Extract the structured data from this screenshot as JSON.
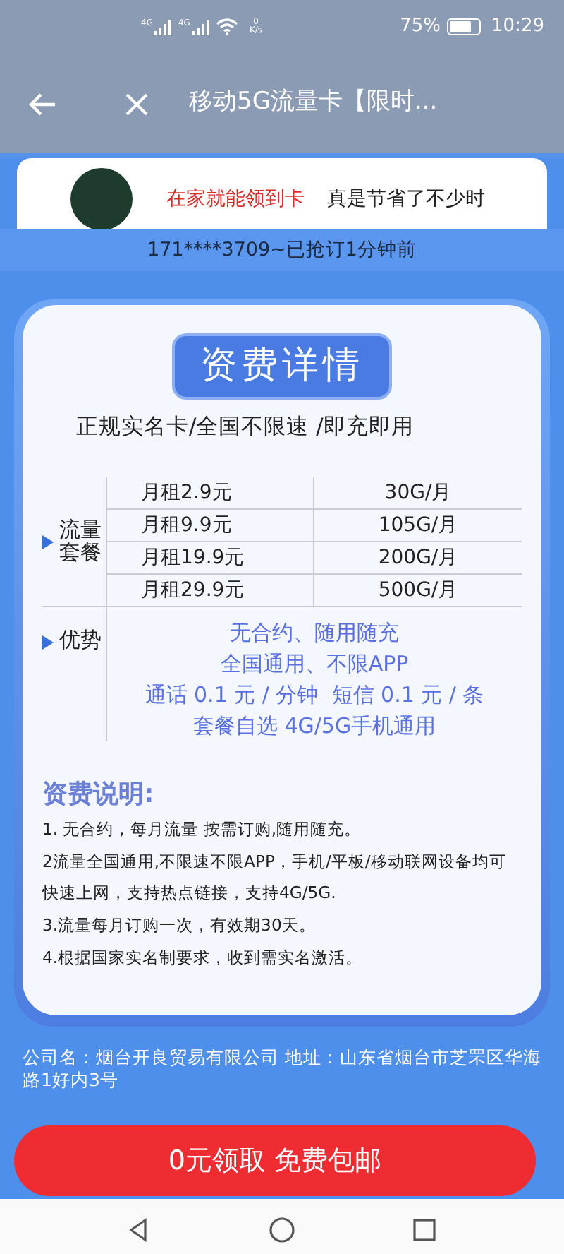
{
  "status_bar": {
    "network_labels": [
      "4G",
      "4G"
    ],
    "speed_value": "0",
    "speed_unit": "K/s",
    "battery": "75%",
    "time": "10:29"
  },
  "header": {
    "title": "移动5G流量卡【限时..."
  },
  "review": {
    "highlight": "在家就能领到卡",
    "text": "真是节省了不少时"
  },
  "ticker": "171****3709~已抢订1分钟前",
  "pricing": {
    "title": "资费详情",
    "subtitle": "正规实名卡/全国不限速 /即充即用",
    "plans_label": "流量套餐",
    "plans": [
      {
        "price": "月租2.9元",
        "data": "30G/月"
      },
      {
        "price": "月租9.9元",
        "data": "105G/月"
      },
      {
        "price": "月租19.9元",
        "data": "200G/月"
      },
      {
        "price": "月租29.9元",
        "data": "500G/月"
      }
    ],
    "advantages_label": "优势",
    "advantages": [
      "无合约、随用随充",
      "全国通用、不限APP",
      "通话 0.1 元 / 分钟  短信 0.1 元 / 条",
      "套餐自选 4G/5G手机通用"
    ],
    "notes_title": "资费说明:",
    "notes": [
      "1. 无合约，每月流量 按需订购,随用随充。",
      "2流量全国通用,不限速不限APP，手机/平板/移动联网设备均可快速上网，支持热点链接，支持4G/5G.",
      "3.流量每月订购一次，有效期30天。",
      "4.根据国家实名制要求，收到需实名激活。"
    ]
  },
  "company": "公司名：烟台开良贸易有限公司 地址：山东省烟台市芝罘区华海路1好内3号",
  "cta": "0元领取 免费包邮"
}
